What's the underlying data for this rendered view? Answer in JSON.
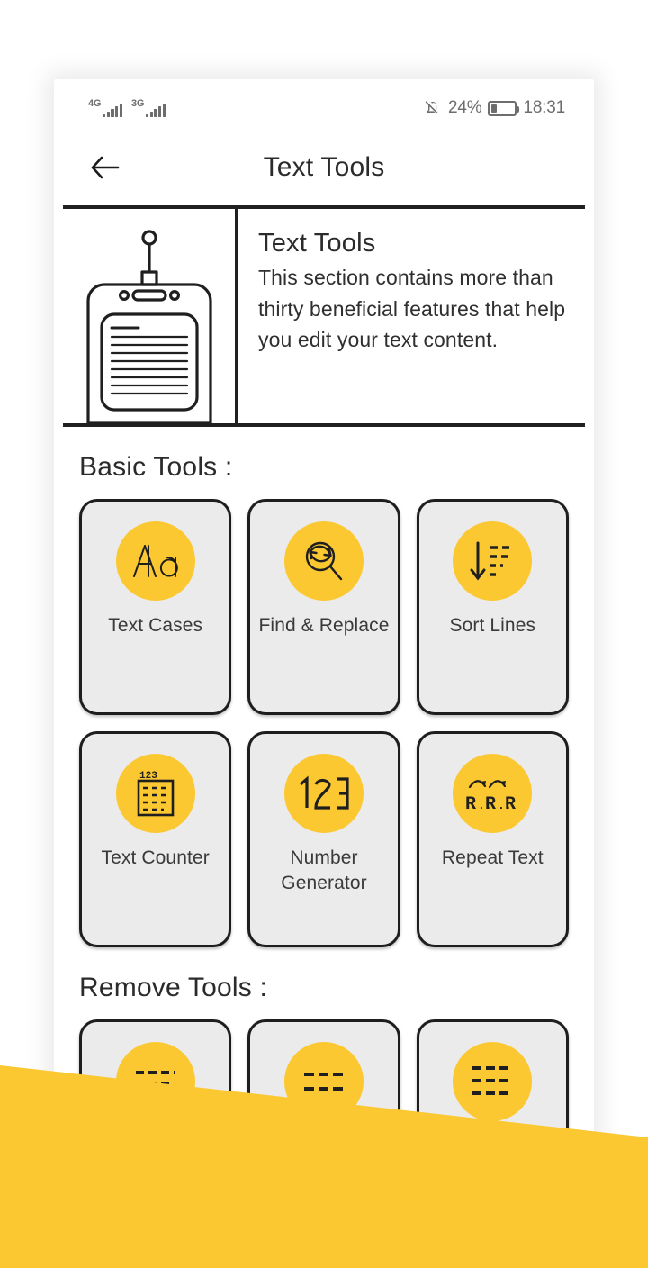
{
  "status_bar": {
    "network_1": "4G",
    "network_2": "3G",
    "mute_icon": "bell-mute-icon",
    "battery_percent": "24%",
    "battery_level": 24,
    "time": "18:31"
  },
  "app_bar": {
    "back_icon": "arrow-left-icon",
    "title": "Text Tools"
  },
  "banner": {
    "illustration": "radio-text-device-illustration",
    "title": "Text Tools",
    "description": "This section contains more than thirty beneficial features that help you edit your text content."
  },
  "sections": [
    {
      "heading": "Basic Tools :",
      "tools": [
        {
          "label": "Text Cases",
          "icon": "aa-letters-icon"
        },
        {
          "label": "Find & Replace",
          "icon": "magnifier-refresh-icon"
        },
        {
          "label": "Sort Lines",
          "icon": "sort-descending-icon"
        },
        {
          "label": "Text Counter",
          "icon": "document-123-icon"
        },
        {
          "label": "Number Generator",
          "icon": "digits-123-icon"
        },
        {
          "label": "Repeat Text",
          "icon": "repeat-r-r-r-icon"
        }
      ]
    },
    {
      "heading": "Remove Tools :",
      "tools": [
        {
          "label": "",
          "icon": "remove-lines-icon-1"
        },
        {
          "label": "",
          "icon": "remove-lines-icon-2"
        },
        {
          "label": "",
          "icon": "remove-lines-icon-3"
        }
      ]
    }
  ],
  "colors": {
    "accent_yellow": "#FBC832",
    "card_background": "#EBEBEB",
    "card_border": "#1E1E1E",
    "text_primary": "#2B2B2B",
    "overlay_yellow": "#FBC832"
  }
}
